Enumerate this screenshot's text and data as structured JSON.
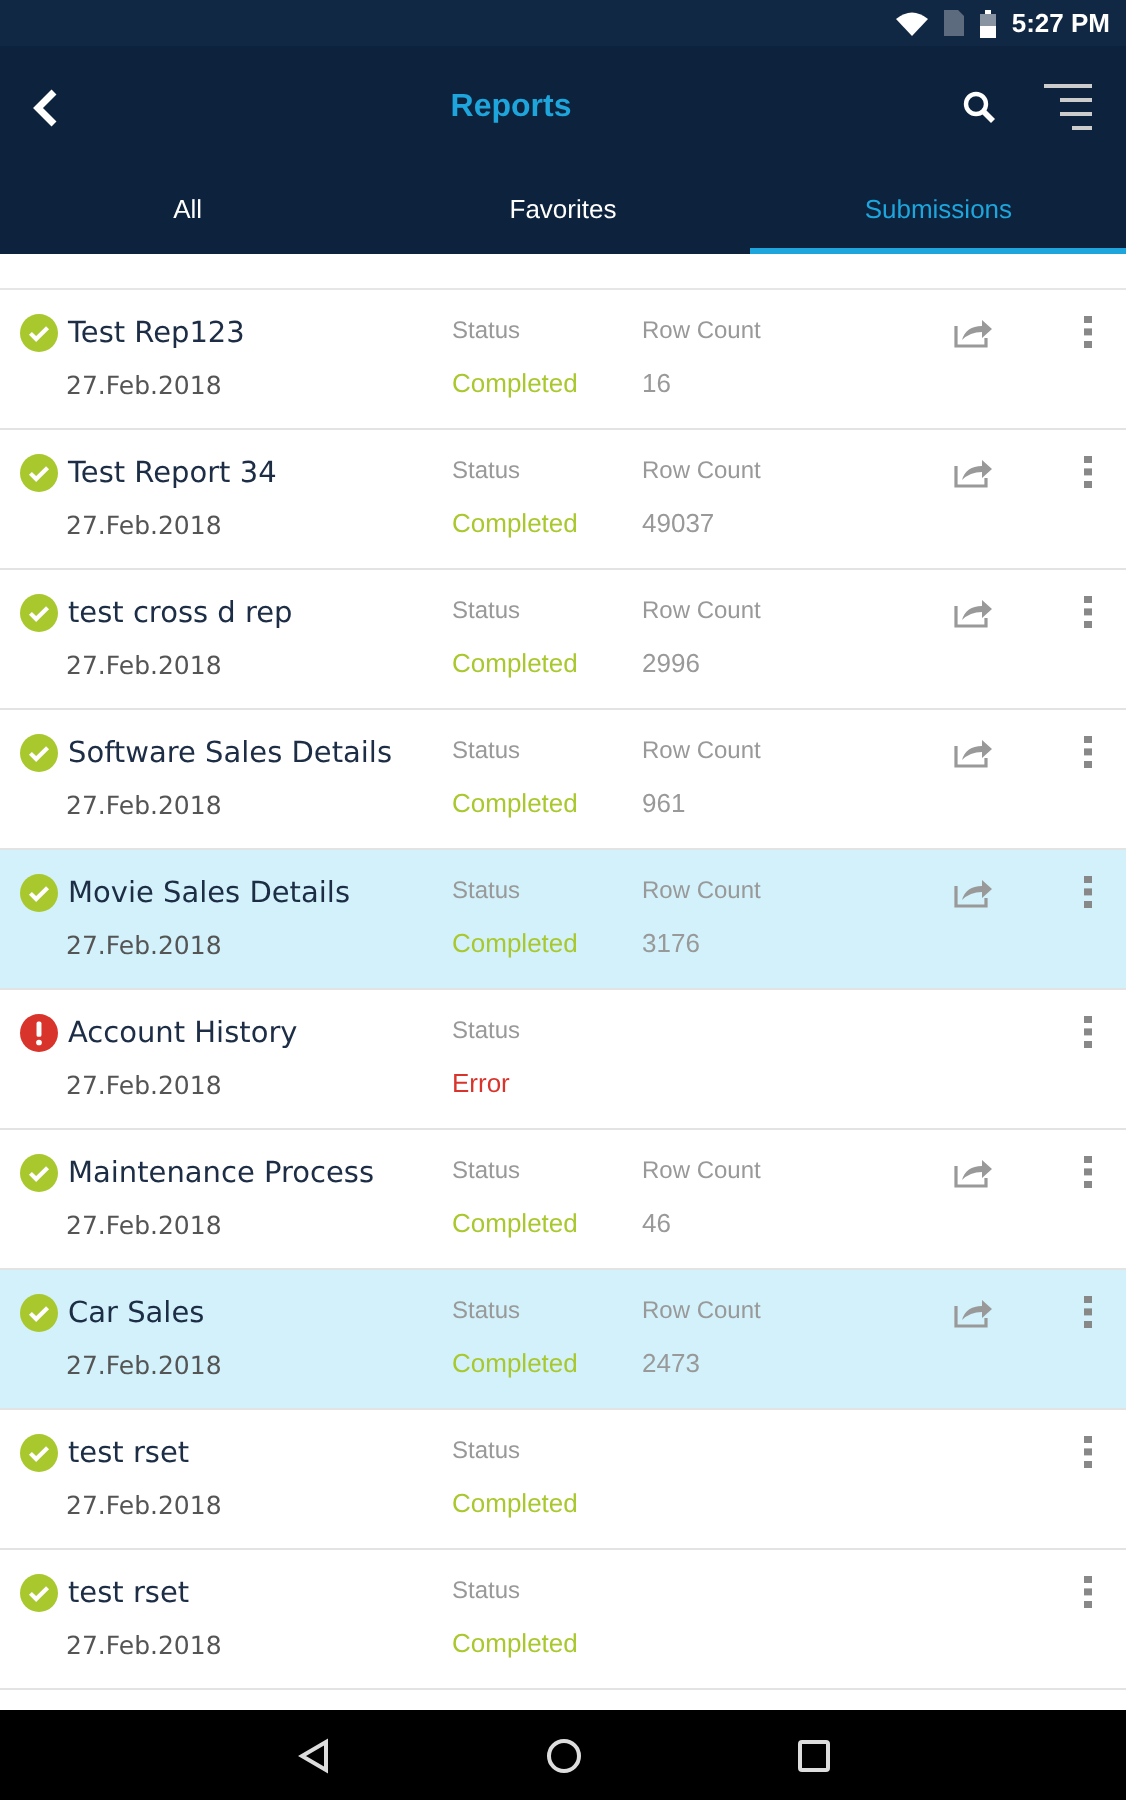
{
  "status_bar": {
    "time": "5:27 PM"
  },
  "header": {
    "title": "Reports"
  },
  "tabs": [
    {
      "label": "All",
      "selected": false
    },
    {
      "label": "Favorites",
      "selected": false
    },
    {
      "label": "Submissions",
      "selected": true
    }
  ],
  "reports": [
    {
      "name": "Test Rep123",
      "date": "27.Feb.2018",
      "status_label": "Status",
      "status": "Completed",
      "kind": "completed",
      "count_label": "Row Count",
      "row_count": "16",
      "shareable": true,
      "selected": false
    },
    {
      "name": "Test Report 34",
      "date": "27.Feb.2018",
      "status_label": "Status",
      "status": "Completed",
      "kind": "completed",
      "count_label": "Row Count",
      "row_count": "49037",
      "shareable": true,
      "selected": false
    },
    {
      "name": "test cross d rep",
      "date": "27.Feb.2018",
      "status_label": "Status",
      "status": "Completed",
      "kind": "completed",
      "count_label": "Row Count",
      "row_count": "2996",
      "shareable": true,
      "selected": false
    },
    {
      "name": "Software Sales Details",
      "date": "27.Feb.2018",
      "status_label": "Status",
      "status": "Completed",
      "kind": "completed",
      "count_label": "Row Count",
      "row_count": "961",
      "shareable": true,
      "selected": false
    },
    {
      "name": "Movie Sales Details",
      "date": "27.Feb.2018",
      "status_label": "Status",
      "status": "Completed",
      "kind": "completed",
      "count_label": "Row Count",
      "row_count": "3176",
      "shareable": true,
      "selected": true
    },
    {
      "name": "Account History",
      "date": "27.Feb.2018",
      "status_label": "Status",
      "status": "Error",
      "kind": "error",
      "shareable": false,
      "selected": false
    },
    {
      "name": "Maintenance Process",
      "date": "27.Feb.2018",
      "status_label": "Status",
      "status": "Completed",
      "kind": "completed",
      "count_label": "Row Count",
      "row_count": "46",
      "shareable": true,
      "selected": false
    },
    {
      "name": "Car Sales",
      "date": "27.Feb.2018",
      "status_label": "Status",
      "status": "Completed",
      "kind": "completed",
      "count_label": "Row Count",
      "row_count": "2473",
      "shareable": true,
      "selected": true
    },
    {
      "name": "test rset",
      "date": "27.Feb.2018",
      "status_label": "Status",
      "status": "Completed",
      "kind": "completed",
      "shareable": false,
      "selected": false
    },
    {
      "name": "test rset",
      "date": "27.Feb.2018",
      "status_label": "Status",
      "status": "Completed",
      "kind": "completed",
      "shareable": false,
      "selected": false
    }
  ]
}
